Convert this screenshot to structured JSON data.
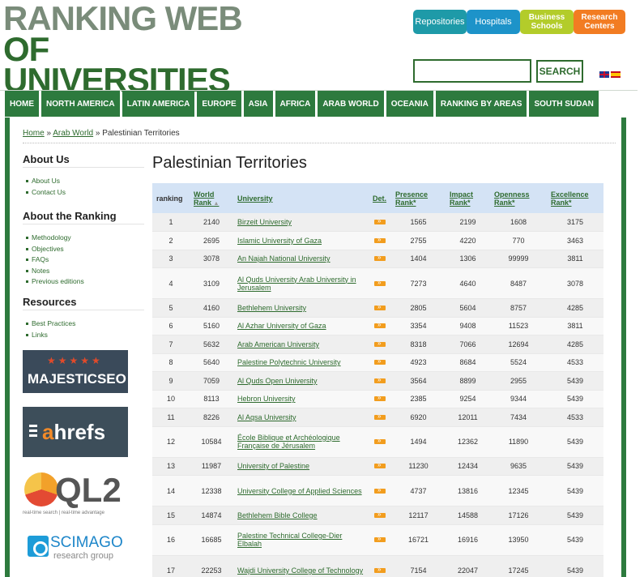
{
  "header": {
    "logo_line1": "RANKING WEB",
    "logo_line2": "OF UNIVERSITIES",
    "top_buttons": [
      "Repositories",
      "Hospitals",
      "Business Schools",
      "Research Centers"
    ],
    "search_value": "",
    "search_button": "SEARCH",
    "lang_flags": [
      "uk-flag-icon",
      "spain-flag-icon"
    ]
  },
  "nav": [
    "HOME",
    "NORTH AMERICA",
    "LATIN AMERICA",
    "EUROPE",
    "ASIA",
    "AFRICA",
    "ARAB WORLD",
    "OCEANIA",
    "RANKING BY AREAS",
    "SOUTH SUDAN"
  ],
  "breadcrumb": {
    "home": "Home",
    "sep": "»",
    "parent": "Arab World",
    "current": "Palestinian Territories"
  },
  "sidebar": {
    "about_title": "About Us",
    "about_items": [
      "About Us",
      "Contact Us"
    ],
    "ranking_title": "About the Ranking",
    "ranking_items": [
      "Methodology",
      "Objectives",
      "FAQs",
      "Notes",
      "Previous editions"
    ],
    "resources_title": "Resources",
    "resources_items": [
      "Best Practices",
      "Links"
    ],
    "partners": {
      "majestic": "MAJESTICSEO",
      "ahrefs_a": "a",
      "ahrefs_rest": "hrefs",
      "ql2": "QL2",
      "ql2_tagline": "real-time search | real-time advantage",
      "scimago": "SCIMAGO",
      "scimago_sub": "research group"
    }
  },
  "main": {
    "title": "Palestinian Territories",
    "columns": {
      "ranking": "ranking",
      "world": "World Rank",
      "university": "University",
      "det": "Det.",
      "presence": "Presence Rank*",
      "impact": "Impact Rank*",
      "openness": "Openness Rank*",
      "excellence": "Excellence Rank*"
    },
    "rows": [
      {
        "ranking": "1",
        "world": "2140",
        "university": "Birzeit University",
        "presence": "1565",
        "impact": "2199",
        "openness": "1608",
        "excellence": "3175"
      },
      {
        "ranking": "2",
        "world": "2695",
        "university": "Islamic University of Gaza",
        "presence": "2755",
        "impact": "4220",
        "openness": "770",
        "excellence": "3463"
      },
      {
        "ranking": "3",
        "world": "3078",
        "university": "An Najah National University",
        "presence": "1404",
        "impact": "1306",
        "openness": "99999",
        "excellence": "3811"
      },
      {
        "ranking": "4",
        "world": "3109",
        "university": "Al Quds University Arab University in Jerusalem",
        "presence": "7273",
        "impact": "4640",
        "openness": "8487",
        "excellence": "3078"
      },
      {
        "ranking": "5",
        "world": "4160",
        "university": "Bethlehem University",
        "presence": "2805",
        "impact": "5604",
        "openness": "8757",
        "excellence": "4285"
      },
      {
        "ranking": "6",
        "world": "5160",
        "university": "Al Azhar University of Gaza",
        "presence": "3354",
        "impact": "9408",
        "openness": "11523",
        "excellence": "3811"
      },
      {
        "ranking": "7",
        "world": "5632",
        "university": "Arab American University",
        "presence": "8318",
        "impact": "7066",
        "openness": "12694",
        "excellence": "4285"
      },
      {
        "ranking": "8",
        "world": "5640",
        "university": "Palestine Polytechnic University",
        "presence": "4923",
        "impact": "8684",
        "openness": "5524",
        "excellence": "4533"
      },
      {
        "ranking": "9",
        "world": "7059",
        "university": "Al Quds Open University",
        "presence": "3564",
        "impact": "8899",
        "openness": "2955",
        "excellence": "5439"
      },
      {
        "ranking": "10",
        "world": "8113",
        "university": "Hebron University",
        "presence": "2385",
        "impact": "9254",
        "openness": "9344",
        "excellence": "5439"
      },
      {
        "ranking": "11",
        "world": "8226",
        "university": "Al Aqsa University",
        "presence": "6920",
        "impact": "12011",
        "openness": "7434",
        "excellence": "4533"
      },
      {
        "ranking": "12",
        "world": "10584",
        "university": "École Biblique et Archéologique Française de Jérusalem",
        "presence": "1494",
        "impact": "12362",
        "openness": "11890",
        "excellence": "5439"
      },
      {
        "ranking": "13",
        "world": "11987",
        "university": "University of Palestine",
        "presence": "11230",
        "impact": "12434",
        "openness": "9635",
        "excellence": "5439"
      },
      {
        "ranking": "14",
        "world": "12338",
        "university": "University College of Applied Sciences",
        "presence": "4737",
        "impact": "13816",
        "openness": "12345",
        "excellence": "5439"
      },
      {
        "ranking": "15",
        "world": "14874",
        "university": "Bethlehem Bible College",
        "presence": "12117",
        "impact": "14588",
        "openness": "17126",
        "excellence": "5439"
      },
      {
        "ranking": "16",
        "world": "16685",
        "university": "Palestine Technical College-Dier Elbalah",
        "presence": "16721",
        "impact": "16916",
        "openness": "13950",
        "excellence": "5439"
      },
      {
        "ranking": "17",
        "world": "22253",
        "university": "Wajdi University College of Technology",
        "presence": "7154",
        "impact": "22047",
        "openness": "17245",
        "excellence": "5439"
      }
    ]
  },
  "colors": {
    "brand_green": "#2d7a3e",
    "header_blue": "#d4e3f5",
    "det_orange": "#f29d1e"
  }
}
